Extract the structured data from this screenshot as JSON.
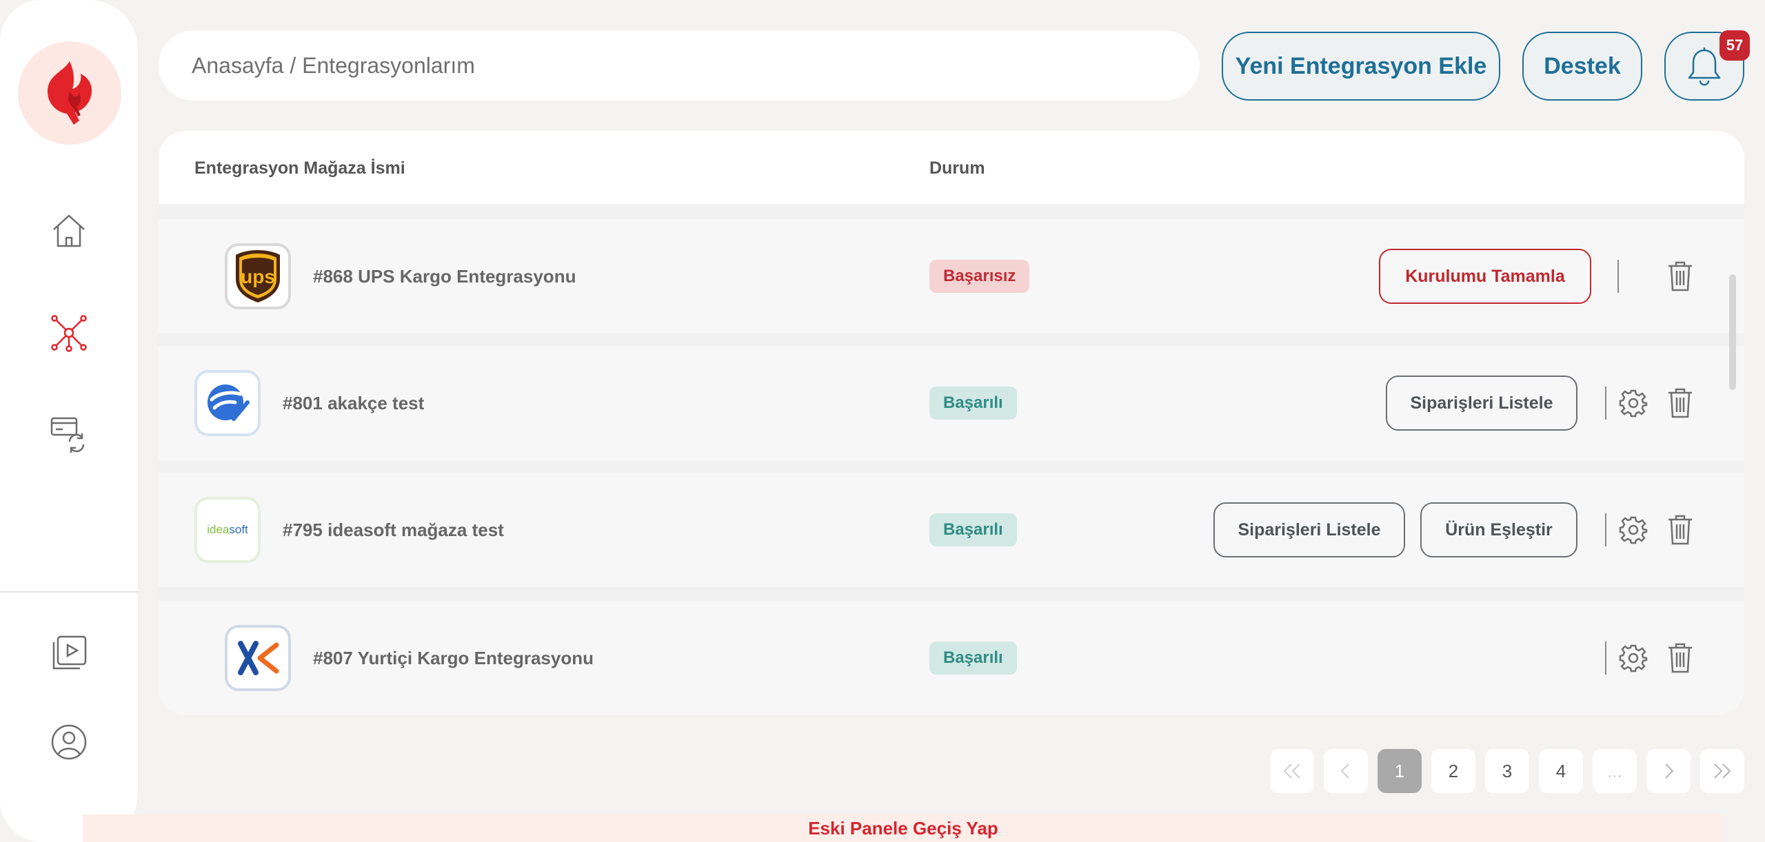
{
  "breadcrumb": "Anasayfa / Entegrasyonlarım",
  "header": {
    "add_integration_label": "Yeni Entegrasyon Ekle",
    "support_label": "Destek",
    "notification_count": "57"
  },
  "sidebar": {
    "items": [
      {
        "icon": "home-icon"
      },
      {
        "icon": "integrations-network-icon",
        "active": true
      },
      {
        "icon": "payment-sync-icon"
      },
      {
        "icon": "video-tutorials-icon"
      },
      {
        "icon": "user-profile-icon"
      }
    ]
  },
  "table": {
    "columns": [
      "Entegrasyon Mağaza İsmi",
      "Durum"
    ],
    "rows": [
      {
        "name": "#868 UPS Kargo Entegrasyonu",
        "logo": "ups-logo",
        "status": "Başarısız",
        "actions": [
          "Kurulumu Tamamla"
        ]
      },
      {
        "name": "#801 akakçe test",
        "logo": "akakce-logo",
        "status": "Başarılı",
        "actions": [
          "Siparişleri Listele"
        ]
      },
      {
        "name": "#795 ideasoft mağaza test",
        "logo": "ideasoft-logo",
        "logo_text": "ideasoft",
        "status": "Başarılı",
        "actions": [
          "Siparişleri Listele",
          "Ürün Eşleştir"
        ]
      },
      {
        "name": "#807 Yurtiçi Kargo Entegrasyonu",
        "logo": "yurtici-logo",
        "status": "Başarılı",
        "actions": []
      }
    ]
  },
  "pagination": {
    "pages": [
      "1",
      "2",
      "3",
      "4",
      "..."
    ],
    "current": "1"
  },
  "footer_link": "Eski Panele Geçiş Yap",
  "colors": {
    "brand_red": "#d4252f",
    "accent_blue": "#1e6f97",
    "success_bg": "#d2e8e5",
    "success_text": "#2f8c85",
    "fail_bg": "#f5d3d3",
    "fail_text": "#bf2e37"
  }
}
